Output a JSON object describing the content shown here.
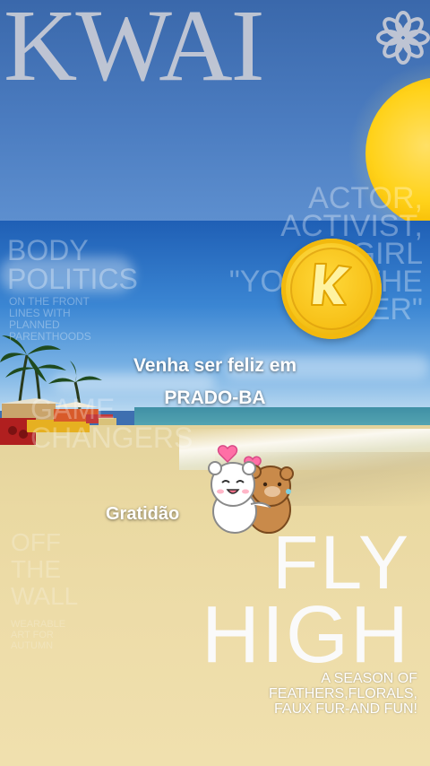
{
  "app": {
    "logo_text": "KWAI",
    "logo_star_icon": "asterisk-flower-icon"
  },
  "story": {
    "caption_line1": "Venha ser feliz em",
    "caption_line2": "PRADO-BA",
    "sticker_caption": "Gratidão",
    "coin_icon": "kwai-coin-icon",
    "sticker_icon": "hugging-bears-sticker"
  },
  "magazine_overlay": {
    "actor_lines": [
      "ACTOR,",
      "ACTIVIST,",
      "IT GIRL",
      "\"YOU'RE THE",
      "LOVER\""
    ],
    "body_lines": [
      "BODY",
      "POLITICS"
    ],
    "body_sub_lines": [
      "ON THE FRONT",
      "LINES WITH",
      "PLANNED",
      "PARENTHOODS"
    ],
    "changers_lines": [
      "GAME",
      "CHANGERS"
    ],
    "wall_lines": [
      "OFF",
      "THE",
      "WALL"
    ],
    "wall_sub_lines": [
      "WEARABLE",
      "ART FOR",
      "AUTUMN"
    ],
    "headline_1": "FLY",
    "headline_2": "HIGH",
    "tagline_lines": [
      "A SEASON OF",
      "FEATHERS,FLORALS,",
      "FAUX FUR-AND FUN!"
    ]
  },
  "colors": {
    "logo": "#c9ccd6",
    "sun": "#ffd21a",
    "coin": "#f7c51a",
    "sky": "#3a68ab",
    "sand": "#eddca8"
  }
}
